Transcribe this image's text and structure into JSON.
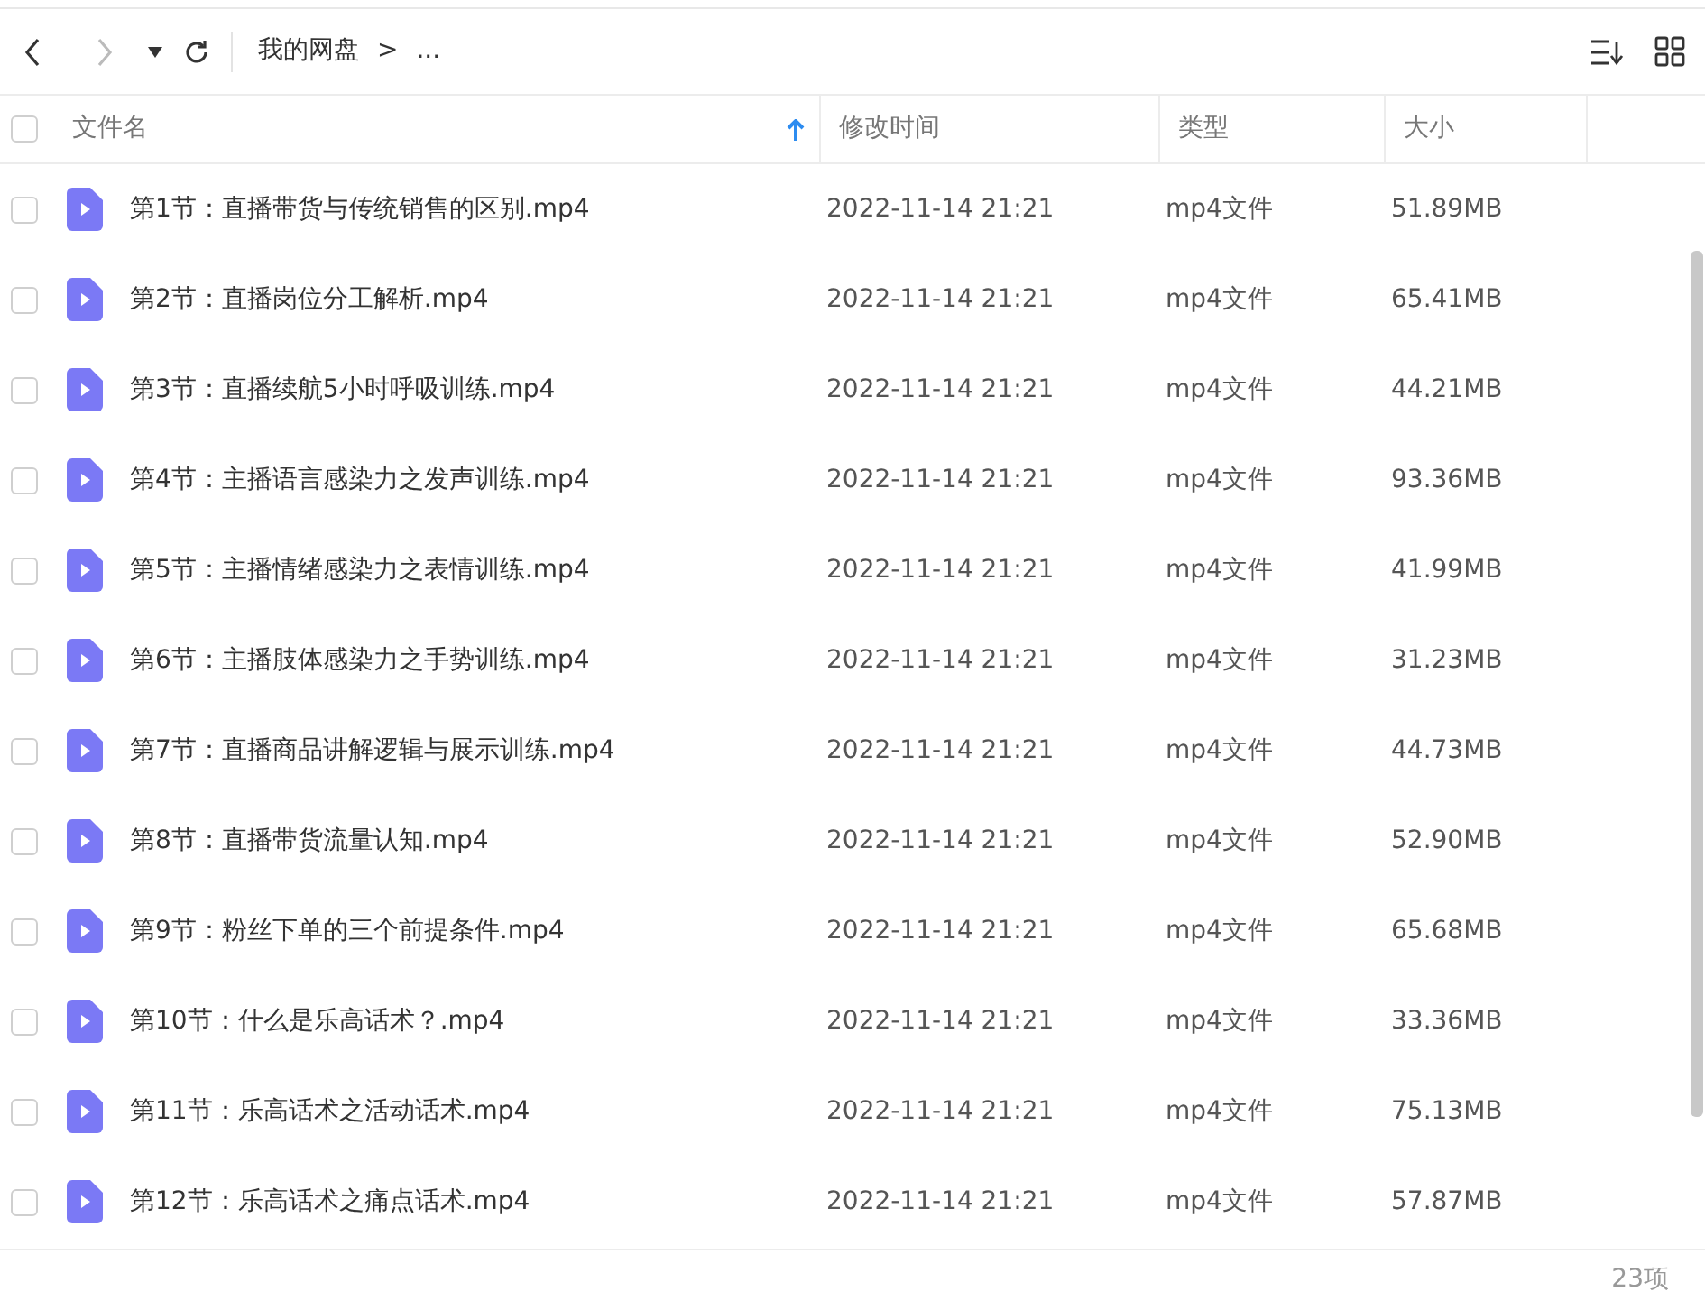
{
  "breadcrumb": {
    "root": "我的网盘",
    "separator": ">",
    "ellipsis": "..."
  },
  "table": {
    "columns": [
      "文件名",
      "修改时间",
      "类型",
      "大小"
    ],
    "all_checked": false,
    "rows": [
      {
        "name": "第1节：直播带货与传统销售的区别.mp4",
        "modified": "2022-11-14 21:21",
        "type": "mp4文件",
        "size": "51.89MB",
        "checked": false
      },
      {
        "name": "第2节：直播岗位分工解析.mp4",
        "modified": "2022-11-14 21:21",
        "type": "mp4文件",
        "size": "65.41MB",
        "checked": false
      },
      {
        "name": "第3节：直播续航5小时呼吸训练.mp4",
        "modified": "2022-11-14 21:21",
        "type": "mp4文件",
        "size": "44.21MB",
        "checked": false
      },
      {
        "name": "第4节：主播语言感染力之发声训练.mp4",
        "modified": "2022-11-14 21:21",
        "type": "mp4文件",
        "size": "93.36MB",
        "checked": false
      },
      {
        "name": "第5节：主播情绪感染力之表情训练.mp4",
        "modified": "2022-11-14 21:21",
        "type": "mp4文件",
        "size": "41.99MB",
        "checked": false
      },
      {
        "name": "第6节：主播肢体感染力之手势训练.mp4",
        "modified": "2022-11-14 21:21",
        "type": "mp4文件",
        "size": "31.23MB",
        "checked": false
      },
      {
        "name": "第7节：直播商品讲解逻辑与展示训练.mp4",
        "modified": "2022-11-14 21:21",
        "type": "mp4文件",
        "size": "44.73MB",
        "checked": false
      },
      {
        "name": "第8节：直播带货流量认知.mp4",
        "modified": "2022-11-14 21:21",
        "type": "mp4文件",
        "size": "52.90MB",
        "checked": false
      },
      {
        "name": "第9节：粉丝下单的三个前提条件.mp4",
        "modified": "2022-11-14 21:21",
        "type": "mp4文件",
        "size": "65.68MB",
        "checked": false
      },
      {
        "name": "第10节：什么是乐高话术？.mp4",
        "modified": "2022-11-14 21:21",
        "type": "mp4文件",
        "size": "33.36MB",
        "checked": false
      },
      {
        "name": "第11节：乐高话术之活动话术.mp4",
        "modified": "2022-11-14 21:21",
        "type": "mp4文件",
        "size": "75.13MB",
        "checked": false
      },
      {
        "name": "第12节：乐高话术之痛点话术.mp4",
        "modified": "2022-11-14 21:21",
        "type": "mp4文件",
        "size": "57.87MB",
        "checked": false
      }
    ]
  },
  "status_bar": {
    "count": "23项"
  }
}
